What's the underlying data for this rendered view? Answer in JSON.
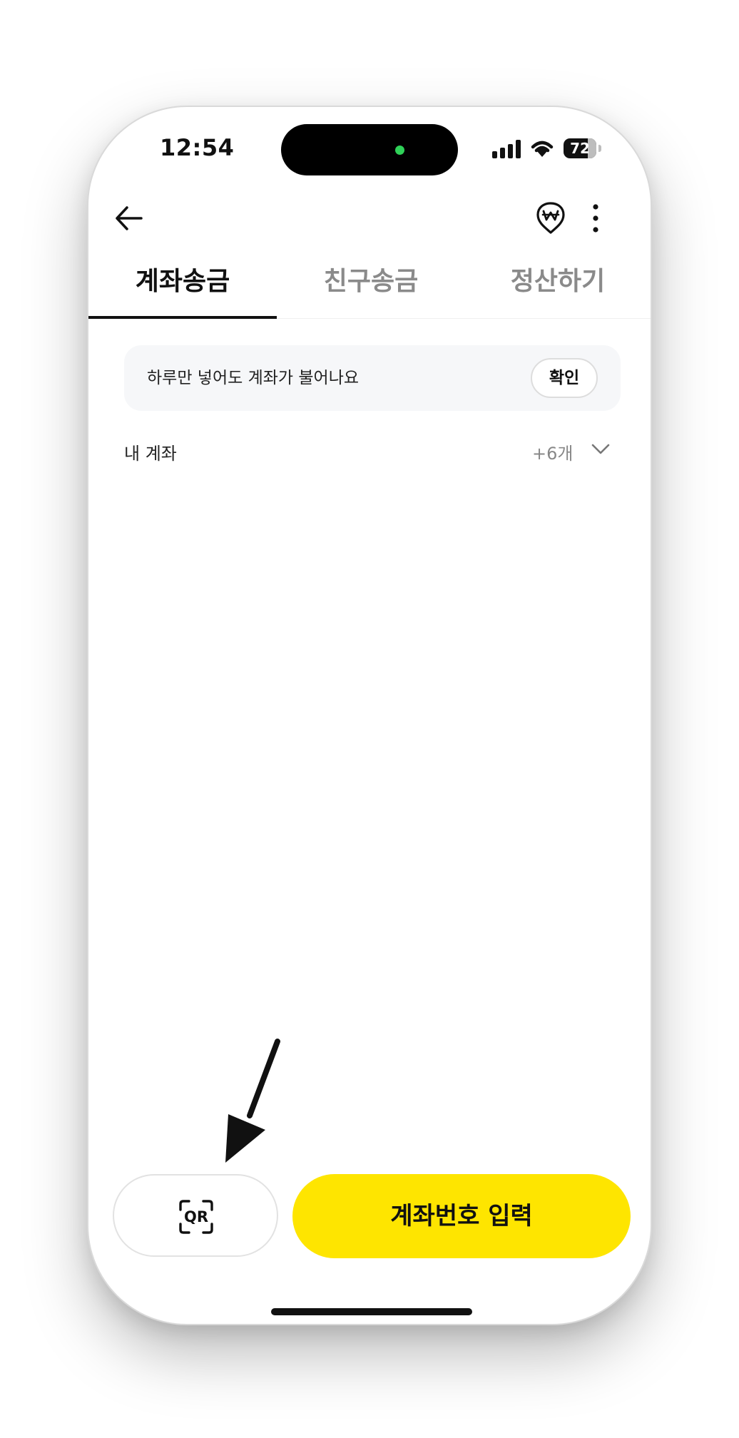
{
  "status_bar": {
    "time": "12:54",
    "battery": "72"
  },
  "tabs": [
    {
      "label": "계좌송금",
      "active": true
    },
    {
      "label": "친구송금",
      "active": false
    },
    {
      "label": "정산하기",
      "active": false
    }
  ],
  "banner": {
    "text": "하루만 넣어도 계좌가 불어나요",
    "button_label": "확인"
  },
  "my_accounts": {
    "label": "내 계좌",
    "count": "+6개"
  },
  "bottom_actions": {
    "qr_label": "QR",
    "primary_label": "계좌번호 입력"
  },
  "colors": {
    "accent_yellow": "#FEE500",
    "active_text": "#111111",
    "inactive_text": "#8A8A8A",
    "banner_bg": "#F6F7F9"
  },
  "icons": {
    "back": "arrow-left-icon",
    "pay": "won-location-icon",
    "more": "more-vertical-icon",
    "chevron": "chevron-down-icon",
    "qr": "qr-scan-icon"
  }
}
